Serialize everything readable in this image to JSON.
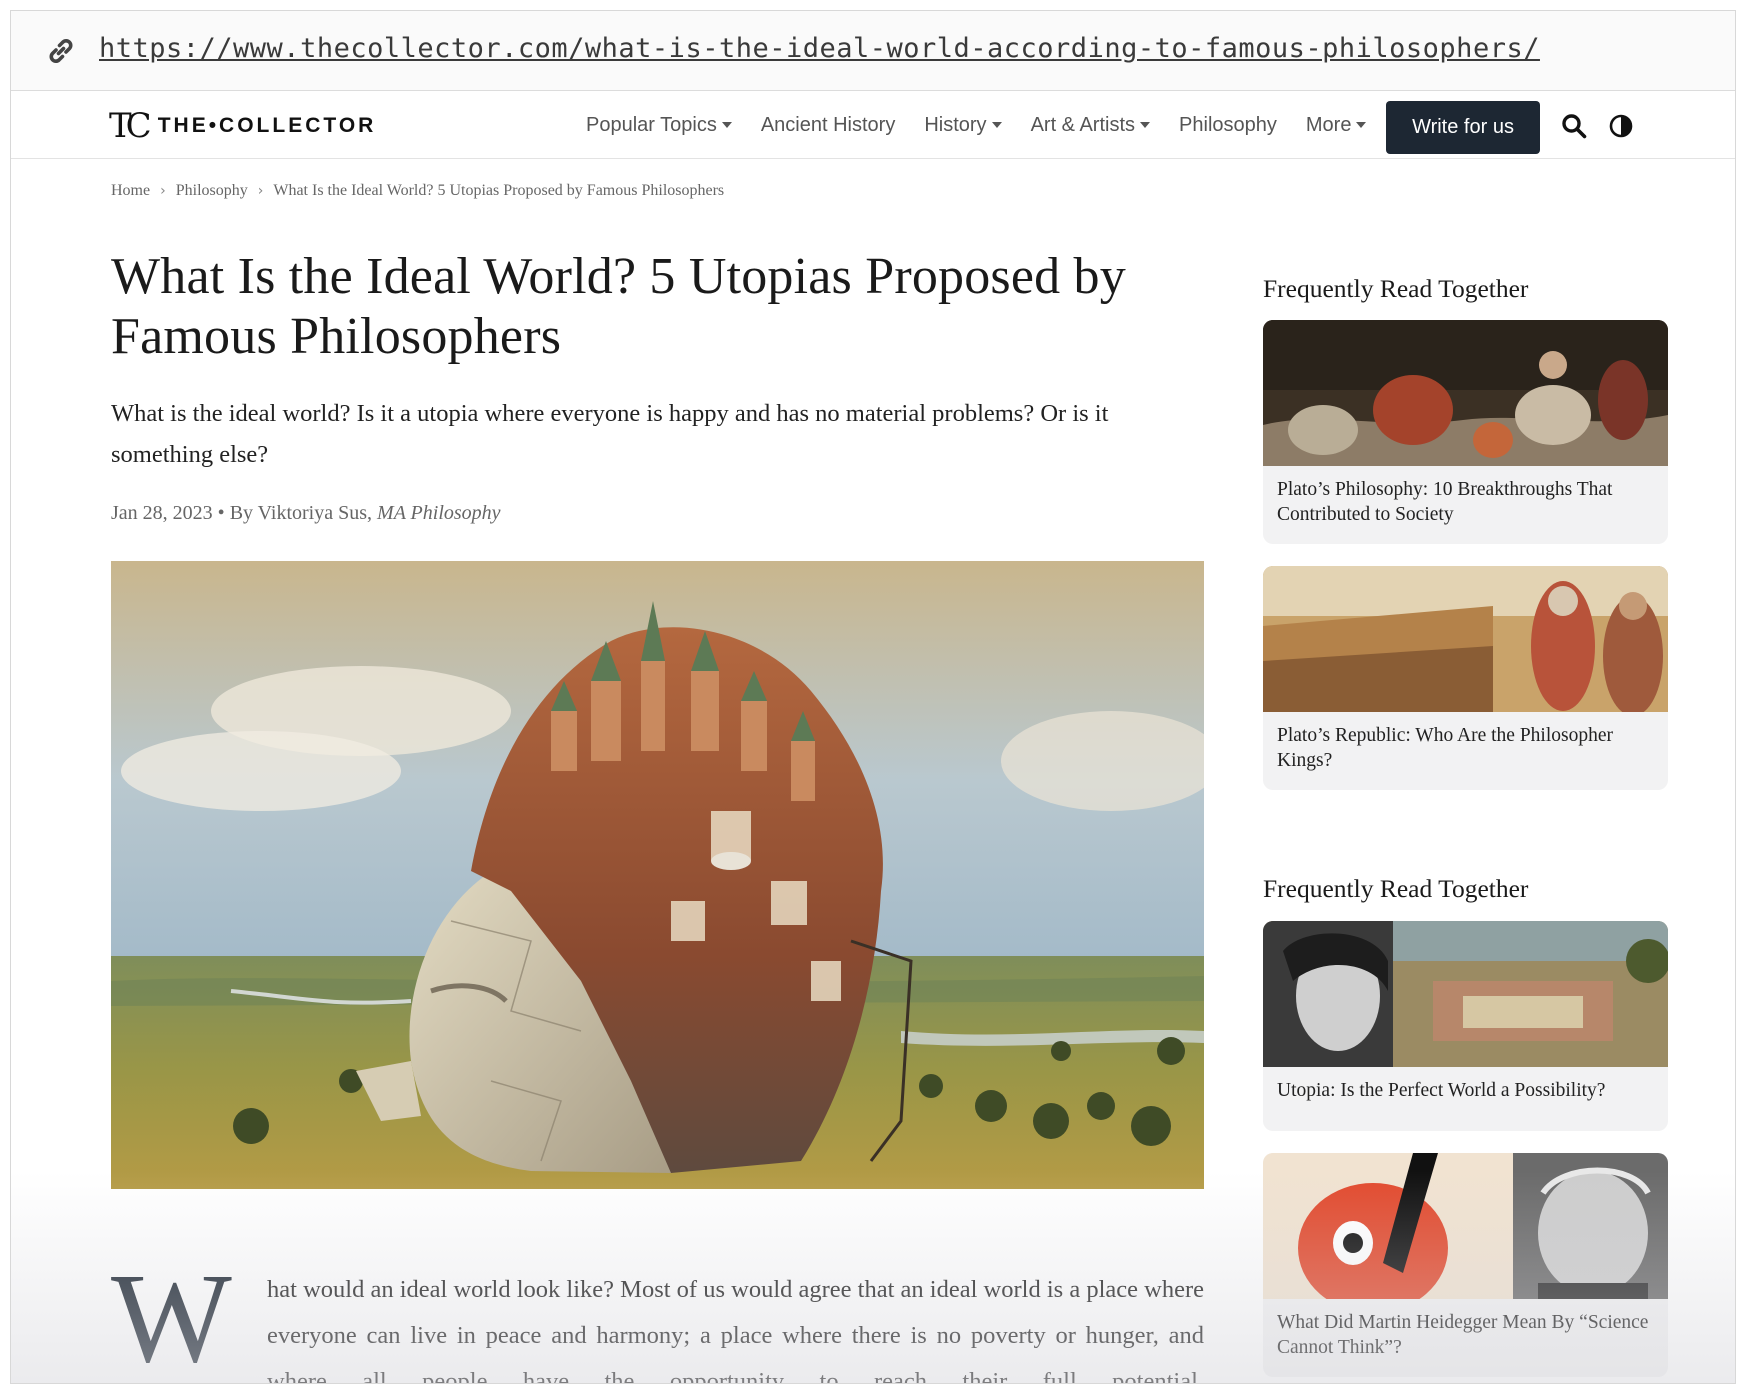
{
  "urlbar": {
    "url": "https://www.thecollector.com/what-is-the-ideal-world-according-to-famous-philosophers/"
  },
  "nav": {
    "logo_mark": "TC",
    "logo_text": "THE•COLLECTOR",
    "items": [
      {
        "label": "Popular Topics",
        "dropdown": true
      },
      {
        "label": "Ancient History",
        "dropdown": false
      },
      {
        "label": "History",
        "dropdown": true
      },
      {
        "label": "Art & Artists",
        "dropdown": true
      },
      {
        "label": "Philosophy",
        "dropdown": false
      },
      {
        "label": "More",
        "dropdown": true
      }
    ],
    "write_button": "Write for us",
    "icons": [
      "search-icon",
      "contrast-icon"
    ]
  },
  "breadcrumb": {
    "home": "Home",
    "section": "Philosophy",
    "current": "What Is the Ideal World? 5 Utopias Proposed by Famous Philosophers"
  },
  "article": {
    "title": "What Is the Ideal World? 5 Utopias Proposed by Famous Philosophers",
    "lead": "What is the ideal world? Is it a utopia where everyone is happy and has no material problems? Or is it something else?",
    "date": "Jan 28, 2023",
    "by_prefix": "By Viktoriya Sus,",
    "credential": "MA Philosophy",
    "dropcap": "W",
    "body": "hat would an ideal world look like? Most of us would agree that an ideal world is a place where everyone can live in peace and harmony; a place where there is no poverty or hunger, and where all people have the opportunity to reach their full potential."
  },
  "sidebar": {
    "sections": [
      {
        "heading": "Frequently Read Together",
        "cards": [
          {
            "title": "Plato’s Philosophy: 10 Breakthroughs That Contributed to Society"
          },
          {
            "title": "Plato’s Republic: Who Are the Philosopher Kings?"
          }
        ]
      },
      {
        "heading": "Frequently Read Together",
        "cards": [
          {
            "title": "Utopia: Is the Perfect World a Possibility?"
          },
          {
            "title": "What Did Martin Heidegger Mean By “Science Cannot Think”?"
          }
        ]
      }
    ]
  },
  "colors": {
    "button_bg": "#1d2733",
    "text": "#1a1a1a",
    "card_bg": "#f2f2f3",
    "muted": "#666666"
  }
}
